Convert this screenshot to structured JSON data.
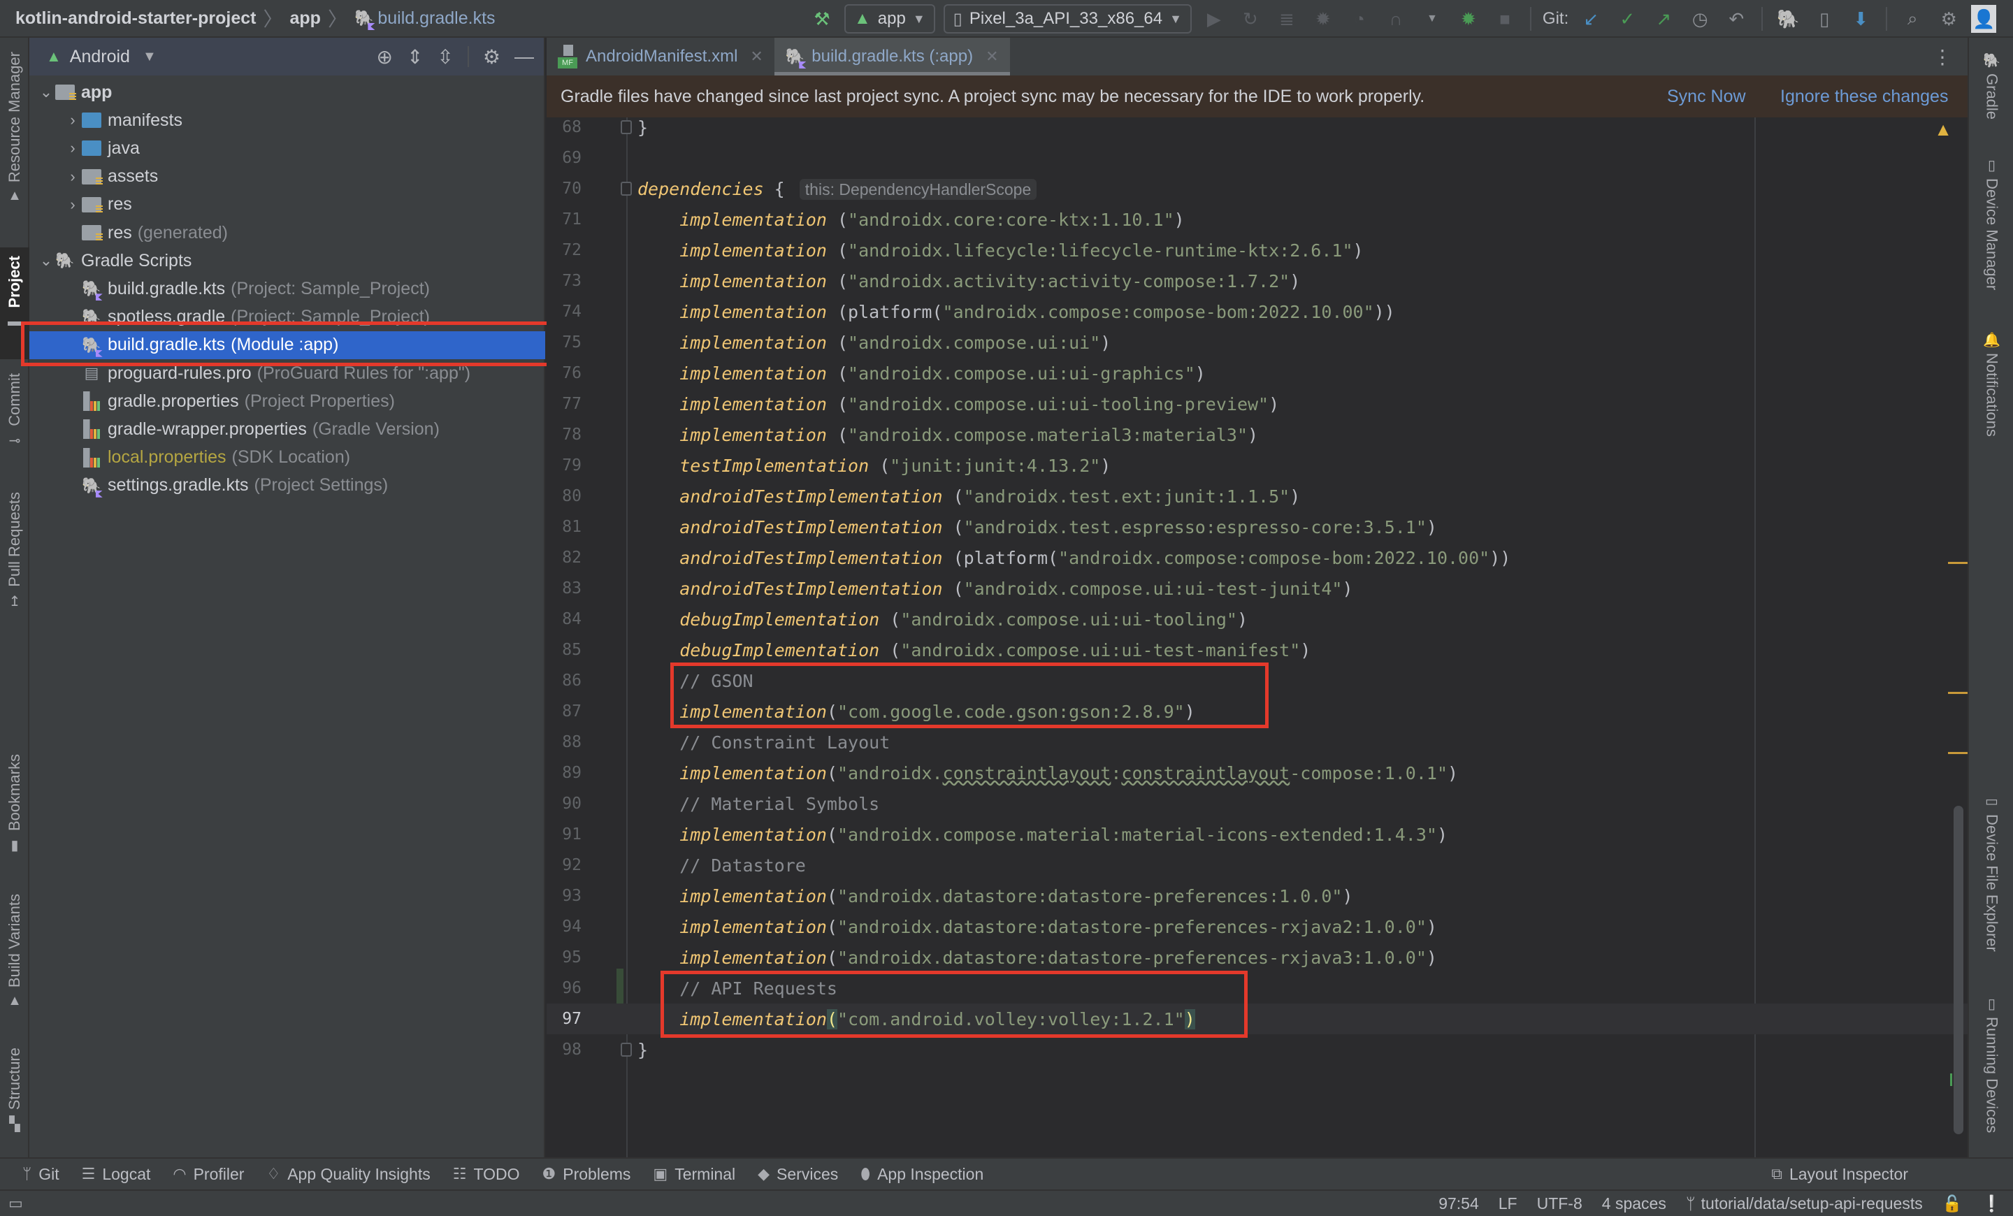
{
  "breadcrumb": {
    "project": "kotlin-android-starter-project",
    "module": "app",
    "file": "build.gradle.kts"
  },
  "toolbar": {
    "run_config": "app",
    "device": "Pixel_3a_API_33_x86_64",
    "git_label": "Git:",
    "icons": [
      "hammer-icon",
      "run-icon",
      "apply-changes-icon",
      "apply-code-changes-icon",
      "debug-icon",
      "profile-icon",
      "coverage-icon",
      "more-run-icon",
      "attach-debugger-icon",
      "stop-icon",
      "git-update-icon",
      "git-commit-icon",
      "git-push-icon",
      "git-history-icon",
      "git-rollback-icon",
      "gradle-sync-icon",
      "device-manager-icon",
      "sdk-manager-icon",
      "search-icon",
      "settings-icon",
      "account-icon"
    ]
  },
  "left_strip": [
    {
      "label": "Resource Manager",
      "icon": "resource-manager-icon",
      "active": false
    },
    {
      "label": "Project",
      "icon": "folder-icon",
      "active": true
    },
    {
      "label": "Commit",
      "icon": "commit-icon",
      "active": false
    },
    {
      "label": "Pull Requests",
      "icon": "pull-requests-icon",
      "active": false
    },
    {
      "label": "Bookmarks",
      "icon": "bookmark-icon",
      "active": false
    },
    {
      "label": "Build Variants",
      "icon": "android-icon",
      "active": false
    },
    {
      "label": "Structure",
      "icon": "structure-icon",
      "active": false
    }
  ],
  "project_panel": {
    "view_mode": "Android",
    "tree": [
      {
        "name": "app",
        "hint": "",
        "level": 0,
        "expanded": true,
        "icon": "module-folder"
      },
      {
        "name": "manifests",
        "hint": "",
        "level": 1,
        "expanded": false,
        "icon": "folder-blue"
      },
      {
        "name": "java",
        "hint": "",
        "level": 1,
        "expanded": false,
        "icon": "folder-blue"
      },
      {
        "name": "assets",
        "hint": "",
        "level": 1,
        "expanded": false,
        "icon": "folder-res"
      },
      {
        "name": "res",
        "hint": "",
        "level": 1,
        "expanded": false,
        "icon": "folder-res"
      },
      {
        "name": "res",
        "hint": "(generated)",
        "level": 1,
        "expanded": null,
        "icon": "folder-res"
      },
      {
        "name": "Gradle Scripts",
        "hint": "",
        "level": 0,
        "expanded": true,
        "icon": "gradle"
      },
      {
        "name": "build.gradle.kts",
        "hint": "(Project: Sample_Project)",
        "level": 1,
        "icon": "gradle-kts"
      },
      {
        "name": "spotless.gradle",
        "hint": "(Project: Sample_Project)",
        "level": 1,
        "icon": "gradle"
      },
      {
        "name": "build.gradle.kts",
        "hint": "(Module :app)",
        "level": 1,
        "icon": "gradle-kts",
        "selected": true
      },
      {
        "name": "proguard-rules.pro",
        "hint": "(ProGuard Rules for \":app\")",
        "level": 1,
        "icon": "text-file"
      },
      {
        "name": "gradle.properties",
        "hint": "(Project Properties)",
        "level": 1,
        "icon": "properties"
      },
      {
        "name": "gradle-wrapper.properties",
        "hint": "(Gradle Version)",
        "level": 1,
        "icon": "properties"
      },
      {
        "name": "local.properties",
        "hint": "(SDK Location)",
        "level": 1,
        "icon": "properties",
        "highlight": "#b5a642"
      },
      {
        "name": "settings.gradle.kts",
        "hint": "(Project Settings)",
        "level": 1,
        "icon": "gradle-kts"
      }
    ]
  },
  "editor_tabs": [
    {
      "label": "AndroidManifest.xml",
      "icon": "manifest-icon",
      "active": false
    },
    {
      "label": "build.gradle.kts (:app)",
      "icon": "gradle-kts-icon",
      "active": true
    }
  ],
  "banner": {
    "message": "Gradle files have changed since last project sync. A project sync may be necessary for the IDE to work properly.",
    "sync_now": "Sync Now",
    "ignore": "Ignore these changes"
  },
  "code": {
    "current_line": 97,
    "lines": [
      {
        "n": 68,
        "tokens": [
          [
            "plain",
            "}"
          ]
        ]
      },
      {
        "n": 69,
        "tokens": []
      },
      {
        "n": 70,
        "tokens": [
          [
            "kw",
            "dependencies"
          ],
          [
            "plain",
            " { "
          ],
          [
            "hint",
            "this: DependencyHandlerScope"
          ]
        ]
      },
      {
        "n": 71,
        "tokens": [
          [
            "plain",
            "    "
          ],
          [
            "kw",
            "implementation"
          ],
          [
            "plain",
            " ("
          ],
          [
            "str",
            "\"androidx.core:core-ktx:1.10.1\""
          ],
          [
            "plain",
            ")"
          ]
        ]
      },
      {
        "n": 72,
        "tokens": [
          [
            "plain",
            "    "
          ],
          [
            "kw",
            "implementation"
          ],
          [
            "plain",
            " ("
          ],
          [
            "str",
            "\"androidx.lifecycle:lifecycle-runtime-ktx:2.6.1\""
          ],
          [
            "plain",
            ")"
          ]
        ]
      },
      {
        "n": 73,
        "tokens": [
          [
            "plain",
            "    "
          ],
          [
            "kw",
            "implementation"
          ],
          [
            "plain",
            " ("
          ],
          [
            "str",
            "\"androidx.activity:activity-compose:1.7.2\""
          ],
          [
            "plain",
            ")"
          ]
        ]
      },
      {
        "n": 74,
        "tokens": [
          [
            "plain",
            "    "
          ],
          [
            "kw",
            "implementation"
          ],
          [
            "plain",
            " (platform("
          ],
          [
            "str",
            "\"androidx.compose:compose-bom:2022.10.00\""
          ],
          [
            "plain",
            "))"
          ]
        ]
      },
      {
        "n": 75,
        "tokens": [
          [
            "plain",
            "    "
          ],
          [
            "kw",
            "implementation"
          ],
          [
            "plain",
            " ("
          ],
          [
            "str",
            "\"androidx.compose.ui:ui\""
          ],
          [
            "plain",
            ")"
          ]
        ]
      },
      {
        "n": 76,
        "tokens": [
          [
            "plain",
            "    "
          ],
          [
            "kw",
            "implementation"
          ],
          [
            "plain",
            " ("
          ],
          [
            "str",
            "\"androidx.compose.ui:ui-graphics\""
          ],
          [
            "plain",
            ")"
          ]
        ]
      },
      {
        "n": 77,
        "tokens": [
          [
            "plain",
            "    "
          ],
          [
            "kw",
            "implementation"
          ],
          [
            "plain",
            " ("
          ],
          [
            "str",
            "\"androidx.compose.ui:ui-tooling-preview\""
          ],
          [
            "plain",
            ")"
          ]
        ]
      },
      {
        "n": 78,
        "tokens": [
          [
            "plain",
            "    "
          ],
          [
            "kw",
            "implementation"
          ],
          [
            "plain",
            " ("
          ],
          [
            "str",
            "\"androidx.compose.material3:material3\""
          ],
          [
            "plain",
            ")"
          ]
        ]
      },
      {
        "n": 79,
        "tokens": [
          [
            "plain",
            "    "
          ],
          [
            "kw",
            "testImplementation"
          ],
          [
            "plain",
            " ("
          ],
          [
            "str",
            "\"junit:junit:4.13.2\""
          ],
          [
            "plain",
            ")"
          ]
        ]
      },
      {
        "n": 80,
        "tokens": [
          [
            "plain",
            "    "
          ],
          [
            "kw",
            "androidTestImplementation"
          ],
          [
            "plain",
            " ("
          ],
          [
            "str",
            "\"androidx.test.ext:junit:1.1.5\""
          ],
          [
            "plain",
            ")"
          ]
        ]
      },
      {
        "n": 81,
        "tokens": [
          [
            "plain",
            "    "
          ],
          [
            "kw",
            "androidTestImplementation"
          ],
          [
            "plain",
            " ("
          ],
          [
            "str",
            "\"androidx.test.espresso:espresso-core:3.5.1\""
          ],
          [
            "plain",
            ")"
          ]
        ]
      },
      {
        "n": 82,
        "tokens": [
          [
            "plain",
            "    "
          ],
          [
            "kw",
            "androidTestImplementation"
          ],
          [
            "plain",
            " (platform("
          ],
          [
            "str",
            "\"androidx.compose:compose-bom:2022.10.00\""
          ],
          [
            "plain",
            "))"
          ]
        ]
      },
      {
        "n": 83,
        "tokens": [
          [
            "plain",
            "    "
          ],
          [
            "kw",
            "androidTestImplementation"
          ],
          [
            "plain",
            " ("
          ],
          [
            "str",
            "\"androidx.compose.ui:ui-test-junit4\""
          ],
          [
            "plain",
            ")"
          ]
        ]
      },
      {
        "n": 84,
        "tokens": [
          [
            "plain",
            "    "
          ],
          [
            "kw",
            "debugImplementation"
          ],
          [
            "plain",
            " ("
          ],
          [
            "str",
            "\"androidx.compose.ui:ui-tooling\""
          ],
          [
            "plain",
            ")"
          ]
        ]
      },
      {
        "n": 85,
        "tokens": [
          [
            "plain",
            "    "
          ],
          [
            "kw",
            "debugImplementation"
          ],
          [
            "plain",
            " ("
          ],
          [
            "str",
            "\"androidx.compose.ui:ui-test-manifest\""
          ],
          [
            "plain",
            ")"
          ]
        ]
      },
      {
        "n": 86,
        "tokens": [
          [
            "plain",
            "    "
          ],
          [
            "cm",
            "// GSON"
          ]
        ]
      },
      {
        "n": 87,
        "tokens": [
          [
            "plain",
            "    "
          ],
          [
            "kw",
            "implementation"
          ],
          [
            "plain",
            "("
          ],
          [
            "str",
            "\"com.google.code.gson:gson:2.8.9\""
          ],
          [
            "plain",
            ")"
          ]
        ]
      },
      {
        "n": 88,
        "tokens": [
          [
            "plain",
            "    "
          ],
          [
            "cm",
            "// Constraint Layout"
          ]
        ]
      },
      {
        "n": 89,
        "tokens": [
          [
            "plain",
            "    "
          ],
          [
            "kw",
            "implementation"
          ],
          [
            "plain",
            "("
          ],
          [
            "str",
            "\"androidx."
          ],
          [
            "sq",
            "constraintlayout"
          ],
          [
            "str",
            ":"
          ],
          [
            "sq",
            "constraintlayout"
          ],
          [
            "str",
            "-compose:1.0.1\""
          ],
          [
            "plain",
            ")"
          ]
        ]
      },
      {
        "n": 90,
        "tokens": [
          [
            "plain",
            "    "
          ],
          [
            "cm",
            "// Material Symbols"
          ]
        ]
      },
      {
        "n": 91,
        "tokens": [
          [
            "plain",
            "    "
          ],
          [
            "kw",
            "implementation"
          ],
          [
            "plain",
            "("
          ],
          [
            "str",
            "\"androidx.compose.material:material-icons-extended:1.4.3\""
          ],
          [
            "plain",
            ")"
          ]
        ]
      },
      {
        "n": 92,
        "tokens": [
          [
            "plain",
            "    "
          ],
          [
            "cm",
            "// Datastore"
          ]
        ]
      },
      {
        "n": 93,
        "tokens": [
          [
            "plain",
            "    "
          ],
          [
            "kw",
            "implementation"
          ],
          [
            "plain",
            "("
          ],
          [
            "str",
            "\"androidx.datastore:datastore-preferences:1.0.0\""
          ],
          [
            "plain",
            ")"
          ]
        ]
      },
      {
        "n": 94,
        "tokens": [
          [
            "plain",
            "    "
          ],
          [
            "kw",
            "implementation"
          ],
          [
            "plain",
            "("
          ],
          [
            "str",
            "\"androidx.datastore:datastore-preferences-rxjava2:1.0.0\""
          ],
          [
            "plain",
            ")"
          ]
        ]
      },
      {
        "n": 95,
        "tokens": [
          [
            "plain",
            "    "
          ],
          [
            "kw",
            "implementation"
          ],
          [
            "plain",
            "("
          ],
          [
            "str",
            "\"androidx.datastore:datastore-preferences-rxjava3:1.0.0\""
          ],
          [
            "plain",
            ")"
          ]
        ]
      },
      {
        "n": 96,
        "tokens": [
          [
            "plain",
            "    "
          ],
          [
            "cm",
            "// API Requests"
          ]
        ]
      },
      {
        "n": 97,
        "tokens": [
          [
            "plain",
            "    "
          ],
          [
            "kw",
            "implementation"
          ],
          [
            "bm",
            "("
          ],
          [
            "str",
            "\"com.android.volley:volley:1.2.1\""
          ],
          [
            "bm",
            ")"
          ]
        ]
      },
      {
        "n": 98,
        "tokens": [
          [
            "plain",
            "}"
          ]
        ]
      }
    ]
  },
  "right_strip": [
    {
      "label": "Gradle",
      "icon": "gradle-icon"
    },
    {
      "label": "Device Manager",
      "icon": "device-manager-icon"
    },
    {
      "label": "Notifications",
      "icon": "bell-icon"
    },
    {
      "label": "Device File Explorer",
      "icon": "device-file-icon"
    },
    {
      "label": "Running Devices",
      "icon": "running-devices-icon"
    }
  ],
  "bottom_tools": [
    {
      "label": "Git",
      "icon": "git-branch-icon"
    },
    {
      "label": "Logcat",
      "icon": "logcat-icon"
    },
    {
      "label": "Profiler",
      "icon": "profiler-icon"
    },
    {
      "label": "App Quality Insights",
      "icon": "diamond-icon"
    },
    {
      "label": "TODO",
      "icon": "list-icon"
    },
    {
      "label": "Problems",
      "icon": "problems-icon"
    },
    {
      "label": "Terminal",
      "icon": "terminal-icon"
    },
    {
      "label": "Services",
      "icon": "services-icon"
    },
    {
      "label": "App Inspection",
      "icon": "app-inspection-icon"
    }
  ],
  "bottom_right_tool": {
    "label": "Layout Inspector",
    "icon": "layout-inspector-icon"
  },
  "status": {
    "position": "97:54",
    "line_sep": "LF",
    "encoding": "UTF-8",
    "indent": "4 spaces",
    "branch": "tutorial/data/setup-api-requests"
  },
  "colors": {
    "accent_selection": "#2f65ca",
    "highlight_box": "#e4392b",
    "keyword": "#f0c674",
    "string": "#8a9a7b",
    "link": "#6d9bd6"
  }
}
